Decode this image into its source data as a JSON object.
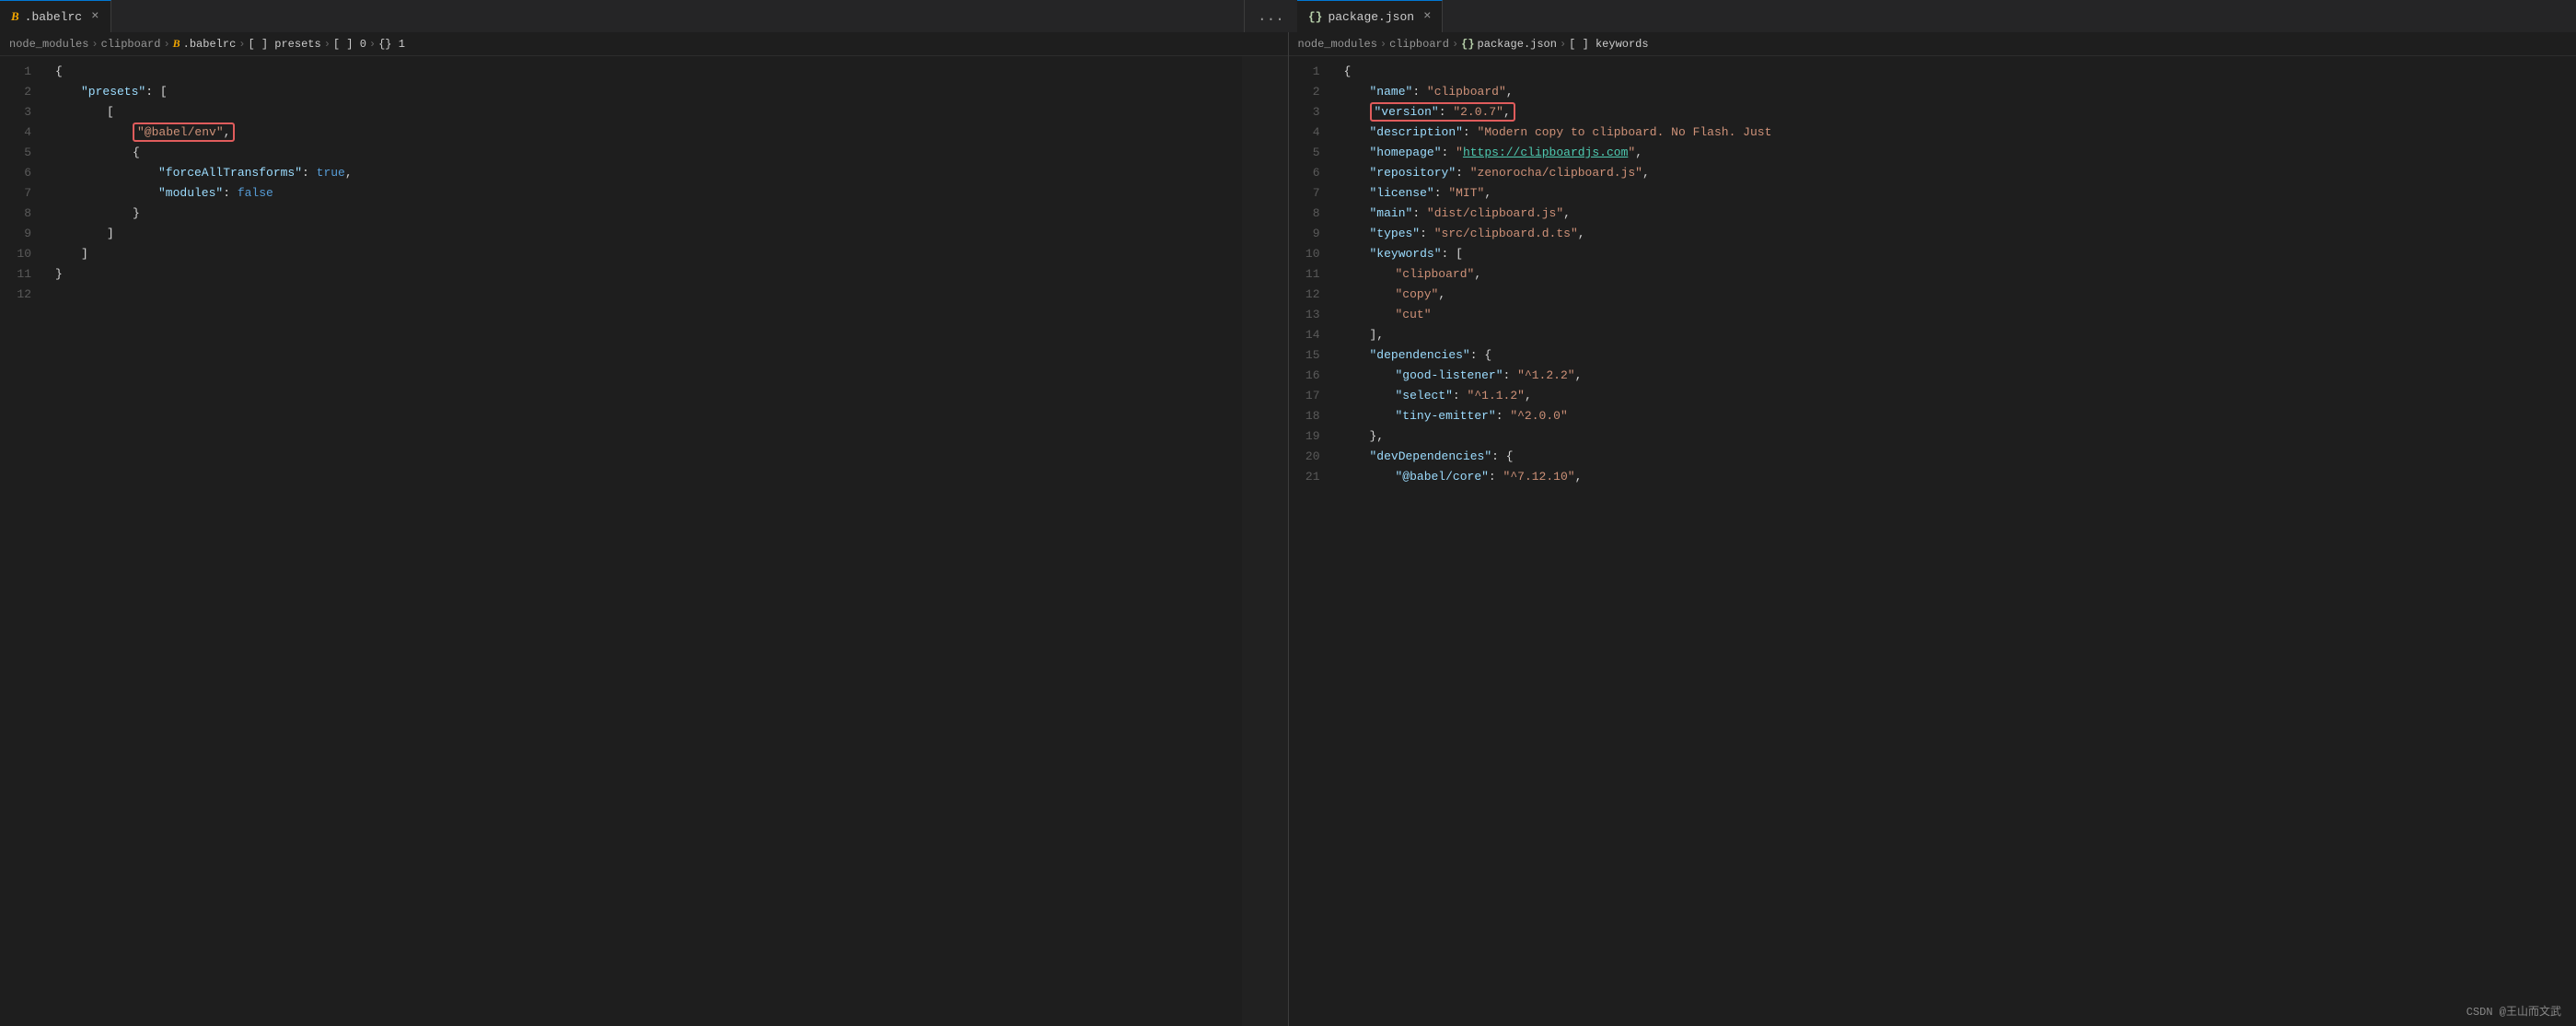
{
  "tabs": {
    "left": {
      "label": ".babelrc",
      "icon": "B",
      "close": "×",
      "active": true
    },
    "right": {
      "label": "package.json",
      "icon": "{}",
      "close": "×",
      "active": true
    },
    "more": "..."
  },
  "breadcrumbs": {
    "left": [
      "node_modules",
      "clipboard",
      "B .babelrc",
      "[ ] presets",
      "[ ] 0",
      "{} 1"
    ],
    "right": [
      "node_modules",
      "clipboard",
      "{} package.json",
      "[ ] keywords"
    ]
  },
  "left_code": [
    {
      "num": 1,
      "text": "{"
    },
    {
      "num": 2,
      "indent": 1,
      "key": "\"presets\"",
      "colon": ":",
      "rest": " ["
    },
    {
      "num": 3,
      "indent": 2,
      "text": "["
    },
    {
      "num": 4,
      "indent": 3,
      "highlight": true,
      "text": "\"@babel/env\","
    },
    {
      "num": 5,
      "indent": 3,
      "text": "{"
    },
    {
      "num": 6,
      "indent": 4,
      "key": "\"forceAllTransforms\"",
      "colon": ":",
      "value_bool": " true,"
    },
    {
      "num": 7,
      "indent": 4,
      "key": "\"modules\"",
      "colon": ":",
      "value_bool": " false"
    },
    {
      "num": 8,
      "indent": 3,
      "text": "}"
    },
    {
      "num": 9,
      "indent": 2,
      "text": "]"
    },
    {
      "num": 10,
      "indent": 1,
      "text": "]"
    },
    {
      "num": 11,
      "indent": 0,
      "text": "}"
    },
    {
      "num": 12,
      "text": ""
    }
  ],
  "right_code": [
    {
      "num": 1,
      "text": "{"
    },
    {
      "num": 2,
      "indent": 1,
      "key": "\"name\"",
      "colon": ":",
      "value_str": " \"clipboard\","
    },
    {
      "num": 3,
      "indent": 1,
      "key": "\"version\"",
      "colon": ":",
      "value_str": " \"2.0.7\",",
      "highlight": true
    },
    {
      "num": 4,
      "indent": 1,
      "key": "\"description\"",
      "colon": ":",
      "value_str": " \"Modern copy to clipboard. No Flash. Just"
    },
    {
      "num": 5,
      "indent": 1,
      "key": "\"homepage\"",
      "colon": ":",
      "value_url": " \"https://clipboardjs.com\","
    },
    {
      "num": 6,
      "indent": 1,
      "key": "\"repository\"",
      "colon": ":",
      "value_str": " \"zenorocha/clipboard.js\","
    },
    {
      "num": 7,
      "indent": 1,
      "key": "\"license\"",
      "colon": ":",
      "value_str": " \"MIT\","
    },
    {
      "num": 8,
      "indent": 1,
      "key": "\"main\"",
      "colon": ":",
      "value_str": " \"dist/clipboard.js\","
    },
    {
      "num": 9,
      "indent": 1,
      "key": "\"types\"",
      "colon": ":",
      "value_str": " \"src/clipboard.d.ts\","
    },
    {
      "num": 10,
      "indent": 1,
      "key": "\"keywords\"",
      "colon": ":",
      "rest": " ["
    },
    {
      "num": 11,
      "indent": 2,
      "value_str": "\"clipboard\","
    },
    {
      "num": 12,
      "indent": 2,
      "value_str": "\"copy\","
    },
    {
      "num": 13,
      "indent": 2,
      "value_str": "\"cut\""
    },
    {
      "num": 14,
      "indent": 1,
      "text": "],"
    },
    {
      "num": 15,
      "indent": 1,
      "key": "\"dependencies\"",
      "colon": ":",
      "rest": " {"
    },
    {
      "num": 16,
      "indent": 2,
      "key": "\"good-listener\"",
      "colon": ":",
      "value_str": " \"^1.2.2\","
    },
    {
      "num": 17,
      "indent": 2,
      "key": "\"select\"",
      "colon": ":",
      "value_str": " \"^1.1.2\","
    },
    {
      "num": 18,
      "indent": 2,
      "key": "\"tiny-emitter\"",
      "colon": ":",
      "value_str": " \"^2.0.0\""
    },
    {
      "num": 19,
      "indent": 1,
      "text": "},"
    },
    {
      "num": 20,
      "indent": 1,
      "key": "\"devDependencies\"",
      "colon": ":",
      "rest": " {"
    },
    {
      "num": 21,
      "indent": 2,
      "key": "\"@babel/core\"",
      "colon": ":",
      "value_str": " \"^7.12.10\","
    }
  ],
  "watermark": "CSDN @王山而文武",
  "colors": {
    "key": "#9cdcfe",
    "string": "#ce9178",
    "bool": "#569cd6",
    "url": "#4ec9b0",
    "highlight_border": "#e05c5c",
    "line_num": "#5a5a5a",
    "bg": "#1e1e1e",
    "tab_bg": "#252526",
    "active_tab_border": "#0078d4"
  }
}
